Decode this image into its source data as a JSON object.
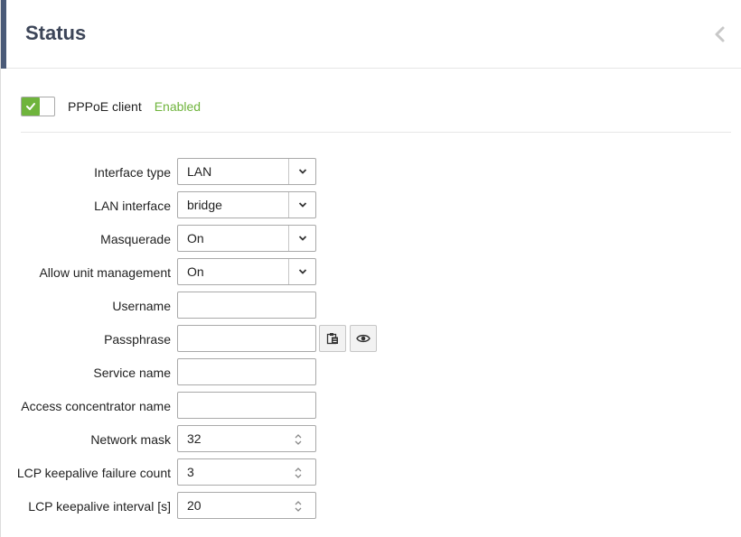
{
  "header": {
    "title": "Status"
  },
  "pppoe": {
    "label": "PPPoE client",
    "state": "Enabled",
    "enabled": true
  },
  "form": {
    "interface_type": {
      "label": "Interface type",
      "value": "LAN"
    },
    "lan_interface": {
      "label": "LAN interface",
      "value": "bridge"
    },
    "masquerade": {
      "label": "Masquerade",
      "value": "On"
    },
    "allow_unit_management": {
      "label": "Allow unit management",
      "value": "On"
    },
    "username": {
      "label": "Username",
      "value": ""
    },
    "passphrase": {
      "label": "Passphrase",
      "value": ""
    },
    "service_name": {
      "label": "Service name",
      "value": ""
    },
    "access_concentrator_name": {
      "label": "Access concentrator name",
      "value": ""
    },
    "network_mask": {
      "label": "Network mask",
      "value": "32"
    },
    "lcp_failure_count": {
      "label": "LCP keepalive failure count",
      "value": "3"
    },
    "lcp_interval": {
      "label": "LCP keepalive interval [s]",
      "value": "20"
    }
  },
  "colors": {
    "accent": "#4a5a78",
    "enabled_green": "#6fb43c",
    "title": "#3c4558"
  },
  "icons": {
    "collapse": "chevron-left-icon",
    "select": "chevron-down-icon",
    "paste": "clipboard-icon",
    "reveal": "eye-icon",
    "spinner": "spinner-arrows-icon",
    "toggle": "check-icon"
  }
}
